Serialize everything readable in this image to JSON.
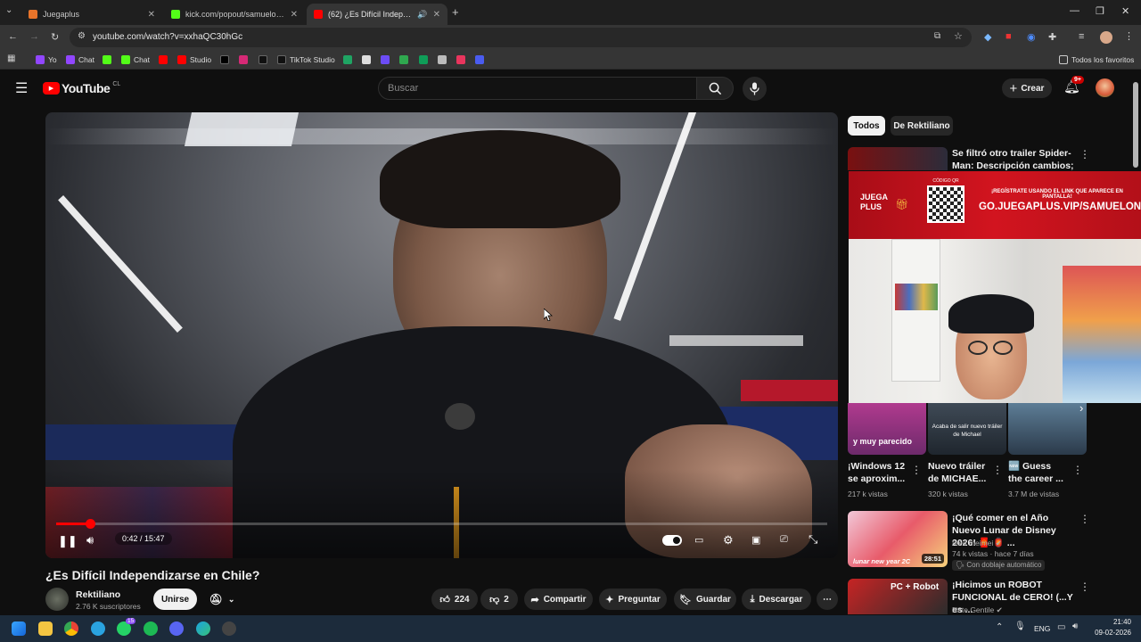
{
  "browser": {
    "tabs": [
      {
        "title": "Juegaplus",
        "color": "#e8742a"
      },
      {
        "title": "kick.com/popout/samuelon/chat",
        "color": "#53fc18"
      },
      {
        "title": "(62) ¿Es Difícil Independizarse en Chile?",
        "color": "#ff0000"
      }
    ],
    "url": "youtube.com/watch?v=xxhaQC30hGc",
    "bookmarks": [
      "Yo",
      "Chat",
      "Chat",
      "Studio",
      "TikTok Studio"
    ],
    "all_bookmarks": "Todos los favoritos"
  },
  "youtube": {
    "logo_text": "YouTube",
    "region": "CL",
    "search_placeholder": "Buscar",
    "create_label": "Crear",
    "notif_badge": "9+"
  },
  "player": {
    "time": "0:42 / 15:47",
    "progress_fraction": 0.0444,
    "overlay": {
      "qr_label": "CÓDIGO QR",
      "brand": "JUEGA PLUS",
      "register_text": "¡REGÍSTRATE USANDO EL LINK QUE APARECE EN PANTALLA!",
      "promo_url": "GO.JUEGAPLUS.VIP/SAMUELON"
    }
  },
  "video": {
    "title": "¿Es Difícil Independizarse en Chile?",
    "channel": "Rektiliano",
    "subscribers": "2.76 K suscriptores",
    "join_label": "Unirse",
    "likes": "224",
    "dislikes": "2",
    "share_label": "Compartir",
    "ask_label": "Preguntar",
    "save_label": "Guardar",
    "download_label": "Descargar"
  },
  "sidebar": {
    "chips": [
      "Todos",
      "De Rektiliano"
    ],
    "top_card": {
      "title": "Se filtró otro trailer Spider-Man: Descripción cambios; Doctor ..."
    },
    "shorts": [
      {
        "title": "¡Windows 12 se aproxim...",
        "views": "217 k vistas",
        "thumb_text": "y muy parecido"
      },
      {
        "title": "Nuevo tráiler de MICHAE...",
        "views": "320 k vistas",
        "thumb_text": "Acaba de salir nuevo tráiler de Michael"
      },
      {
        "title": "🆕 Guess the career ...",
        "views": "3.7 M de vistas",
        "thumb_text": ""
      }
    ],
    "cards": [
      {
        "title": "¡Qué comer en el Año Nuevo Lunar de Disney 2026! 🧧 🏮 ...",
        "channel": "feed meimei",
        "meta": "74 k vistas · hace 7 días",
        "badge": "Con doblaje automático",
        "duration": "28:51",
        "thumb_text": "lunar new year 2C"
      },
      {
        "title": "¡Hicimos un ROBOT FUNCIONAL de CERO! (...Y es ...",
        "channel": "Nate Gentile",
        "meta": "",
        "badge": "",
        "duration": "",
        "thumb_text": "PC + Robot"
      }
    ]
  },
  "taskbar": {
    "lang": "ENG",
    "time": "21:40",
    "date": "09-02-2026",
    "badge": "15"
  },
  "colors": {
    "accent_red": "#ff0000",
    "bg": "#0f0f0f",
    "juega_red": "#c0121b"
  }
}
